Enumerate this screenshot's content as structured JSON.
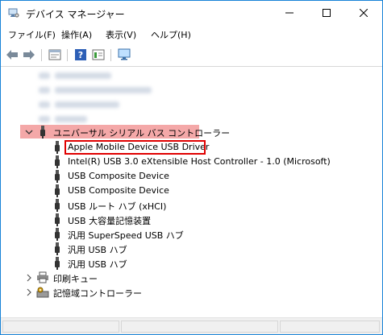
{
  "window": {
    "title": "デバイス マネージャー",
    "accent": "#1883d7"
  },
  "menu": {
    "file": "ファイル(F)",
    "action": "操作(A)",
    "view": "表示(V)",
    "help": "ヘルプ(H)"
  },
  "tree": {
    "usb_category": "ユニバーサル シリアル バス コントローラー",
    "usb_devices": [
      "Apple Mobile Device USB Driver",
      "Intel(R) USB 3.0 eXtensible Host Controller - 1.0 (Microsoft)",
      "USB Composite Device",
      "USB Composite Device",
      "USB ルート ハブ (xHCI)",
      "USB 大容量記憶装置",
      "汎用 SuperSpeed USB ハブ",
      "汎用 USB ハブ",
      "汎用 USB ハブ"
    ],
    "print_queue": "印刷キュー",
    "storage_controllers": "記憶域コントローラー"
  },
  "colors": {
    "category_highlight": "#f4a8a8",
    "selection_border": "#e00000"
  }
}
